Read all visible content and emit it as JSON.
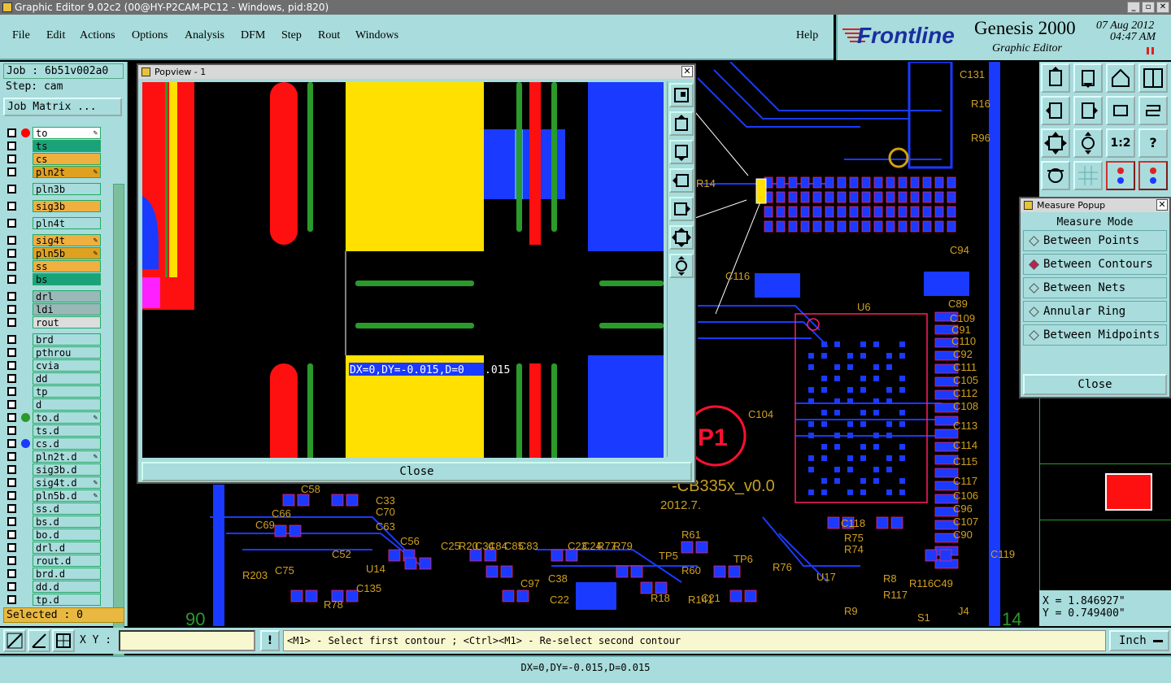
{
  "window": {
    "title": "Graphic Editor 9.02c2 (00@HY-P2CAM-PC12 - Windows, pid:820)"
  },
  "menu": {
    "file": "File",
    "edit": "Edit",
    "actions": "Actions",
    "options": "Options",
    "analysis": "Analysis",
    "dfm": "DFM",
    "step": "Step",
    "rout": "Rout",
    "windows": "Windows",
    "help": "Help"
  },
  "brand": {
    "logo": "Frontline",
    "product": "Genesis 2000",
    "subtitle": "Graphic Editor",
    "date": "07 Aug 2012",
    "time": "04:47 AM"
  },
  "job": {
    "job_label": "Job : 6b51v002a0",
    "step_label": "Step: cam",
    "matrix_button": "Job Matrix ..."
  },
  "layers": [
    {
      "name": "to",
      "color": "#ffffff",
      "dot": "#ff0000",
      "lock": true
    },
    {
      "name": "ts",
      "color": "#1aa37a",
      "dot": "",
      "lock": false
    },
    {
      "name": "cs",
      "color": "#f0b040",
      "dot": "",
      "lock": false
    },
    {
      "name": "pln2t",
      "color": "#e0a020",
      "dot": "",
      "lock": true
    },
    {
      "name": "pln3b",
      "color": "#a9dcdc",
      "dot": "",
      "lock": false
    },
    {
      "name": "sig3b",
      "color": "#f0b040",
      "dot": "",
      "lock": false
    },
    {
      "name": "pln4t",
      "color": "#a9dcdc",
      "dot": "",
      "lock": false
    },
    {
      "name": "sig4t",
      "color": "#f0b040",
      "dot": "",
      "lock": true
    },
    {
      "name": "pln5b",
      "color": "#e0a020",
      "dot": "",
      "lock": true
    },
    {
      "name": "ss",
      "color": "#f0b040",
      "dot": "",
      "lock": false
    },
    {
      "name": "bs",
      "color": "#1aa37a",
      "dot": "",
      "lock": false
    },
    {
      "name": "drl",
      "color": "#9ab8b8",
      "dot": "",
      "lock": false
    },
    {
      "name": "ldi",
      "color": "#9ab8b8",
      "dot": "",
      "lock": false
    },
    {
      "name": "rout",
      "color": "#dddddd",
      "dot": "",
      "lock": false
    },
    {
      "name": "brd",
      "color": "#a9dcdc",
      "dot": "",
      "lock": false
    },
    {
      "name": "pthrou",
      "color": "#a9dcdc",
      "dot": "",
      "lock": false
    },
    {
      "name": "cvia",
      "color": "#a9dcdc",
      "dot": "",
      "lock": false
    },
    {
      "name": "dd",
      "color": "#a9dcdc",
      "dot": "",
      "lock": false
    },
    {
      "name": "tp",
      "color": "#a9dcdc",
      "dot": "",
      "lock": false
    },
    {
      "name": "d",
      "color": "#a9dcdc",
      "dot": "",
      "lock": false
    },
    {
      "name": "to.d",
      "color": "#a9dcdc",
      "dot": "#2a9a2a",
      "lock": true
    },
    {
      "name": "ts.d",
      "color": "#a9dcdc",
      "dot": "",
      "lock": false
    },
    {
      "name": "cs.d",
      "color": "#a9dcdc",
      "dot": "#1a3aff",
      "lock": false
    },
    {
      "name": "pln2t.d",
      "color": "#a9dcdc",
      "dot": "",
      "lock": true
    },
    {
      "name": "sig3b.d",
      "color": "#a9dcdc",
      "dot": "",
      "lock": false
    },
    {
      "name": "sig4t.d",
      "color": "#a9dcdc",
      "dot": "",
      "lock": true
    },
    {
      "name": "pln5b.d",
      "color": "#a9dcdc",
      "dot": "",
      "lock": true
    },
    {
      "name": "ss.d",
      "color": "#a9dcdc",
      "dot": "",
      "lock": false
    },
    {
      "name": "bs.d",
      "color": "#a9dcdc",
      "dot": "",
      "lock": false
    },
    {
      "name": "bo.d",
      "color": "#a9dcdc",
      "dot": "",
      "lock": false
    },
    {
      "name": "drl.d",
      "color": "#a9dcdc",
      "dot": "",
      "lock": false
    },
    {
      "name": "rout.d",
      "color": "#a9dcdc",
      "dot": "",
      "lock": false
    },
    {
      "name": "brd.d",
      "color": "#a9dcdc",
      "dot": "",
      "lock": false
    },
    {
      "name": "dd.d",
      "color": "#a9dcdc",
      "dot": "",
      "lock": false
    },
    {
      "name": "tp.d",
      "color": "#a9dcdc",
      "dot": "",
      "lock": false
    }
  ],
  "selected": "Selected : 0",
  "popview": {
    "title": "Popview - 1",
    "measure_text_hl": "DX=0,DY=-0.015,D=0",
    "measure_text_rest": ".015",
    "close": "Close"
  },
  "measure_popup": {
    "title": "Measure Popup",
    "mode": "Measure Mode",
    "options": [
      "Between Points",
      "Between Contours",
      "Between Nets",
      "Annular Ring",
      "Between Midpoints"
    ],
    "selected_index": 1,
    "close": "Close"
  },
  "pcb": {
    "labels": [
      "C131",
      "R16",
      "R96",
      "R14",
      "C116",
      "C94",
      "C89",
      "U6",
      "C109",
      "C91",
      "C110",
      "C92",
      "C111",
      "C105",
      "C112",
      "C108",
      "C113",
      "C114",
      "C115",
      "C117",
      "C106",
      "C96",
      "C107",
      "C90",
      "C104",
      "C118",
      "R75",
      "R74",
      "C119",
      "C58",
      "C66",
      "C33",
      "C70",
      "C69",
      "C63",
      "C52",
      "C56",
      "C25",
      "R20",
      "C34",
      "C84",
      "C85",
      "C83",
      "C23",
      "C24",
      "R77",
      "R79",
      "C38",
      "TP5",
      "R61",
      "R60",
      "TP6",
      "R76",
      "U17",
      "R8",
      "R117",
      "R116",
      "C49",
      "U14",
      "R203",
      "C75",
      "C135",
      "R78",
      "C97",
      "C22",
      "R18",
      "R141",
      "C21",
      "R9",
      "J4",
      "S1",
      "P1"
    ],
    "board_name": "-CB335x_v0.0",
    "board_date": "2012.7.",
    "corner_left": "90",
    "corner_right": "14"
  },
  "coords": {
    "x": "X = 1.846927\"",
    "y": "Y = 0.749400\""
  },
  "bottom": {
    "xy_label": "X Y :",
    "xy_value": "",
    "prompt": "<M1> - Select first contour ; <Ctrl><M1> - Re-select second contour",
    "units": "Inch"
  },
  "status": "DX=0,DY=-0.015,D=0.015",
  "colors": {
    "panel": "#a9dcdc",
    "pcb_blue": "#1a3aff",
    "pad_yellow": "#ffe000",
    "trace_green": "#2a9a2a",
    "trace_red": "#ff1010"
  }
}
